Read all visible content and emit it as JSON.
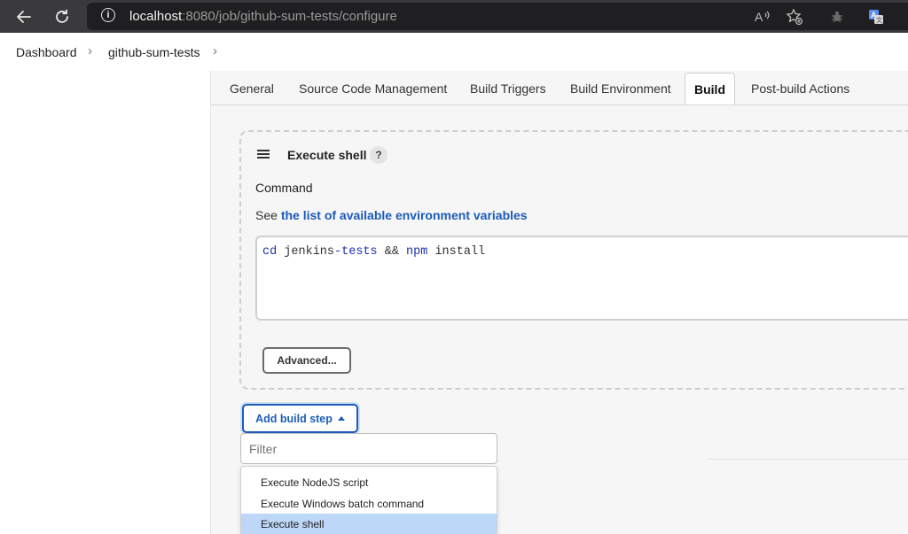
{
  "browser": {
    "url_host": "localhost",
    "url_path": ":8080/job/github-sum-tests/configure"
  },
  "breadcrumb": {
    "items": [
      "Dashboard",
      "github-sum-tests"
    ]
  },
  "tabs": [
    {
      "label": "General"
    },
    {
      "label": "Source Code Management"
    },
    {
      "label": "Build Triggers"
    },
    {
      "label": "Build Environment"
    },
    {
      "label": "Build",
      "active": true
    },
    {
      "label": "Post-build Actions"
    }
  ],
  "build_step": {
    "title": "Execute shell",
    "help": "?",
    "command_label": "Command",
    "see_prefix": "See",
    "see_link": "the list of available environment variables",
    "command_tokens": {
      "t1": "cd",
      "t2": " jenkins",
      "t3": "-tests",
      "t4": " && ",
      "t5": "npm",
      "t6": " install"
    },
    "advanced_button": "Advanced..."
  },
  "add_build_step": {
    "label": "Add build step",
    "filter_placeholder": "Filter",
    "menu_items": [
      "Execute NodeJS script",
      "Execute Windows batch command",
      "Execute shell"
    ],
    "selected_index": 2
  },
  "colors": {
    "accent": "#1c5bb8",
    "selected_item": "#bcd7f7"
  }
}
